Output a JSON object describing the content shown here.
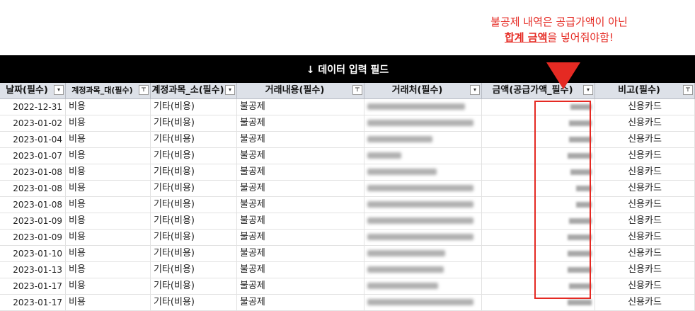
{
  "annotation": {
    "line1": "불공제 내역은 공급가액이 아닌",
    "line2_emph": "합계 금액",
    "line2_rest": "을 넣어줘야함!"
  },
  "banner": {
    "title": "↓ 데이터 입력 필드"
  },
  "columns": [
    {
      "label": "날짜(필수)",
      "filter": "▾"
    },
    {
      "label": "계정과목_대(필수)",
      "filter": "⊤"
    },
    {
      "label": "계정과목_소(필수)",
      "filter": "▾"
    },
    {
      "label": "거래내용(필수)",
      "filter": "⊤"
    },
    {
      "label": "거래처(필수)",
      "filter": "▾"
    },
    {
      "label": "금액(공급가액_필수)",
      "filter": "▾"
    },
    {
      "label": "비고(필수)",
      "filter": "⊤"
    }
  ],
  "rows": [
    {
      "date": "2022-12-31",
      "cat1": "비용",
      "cat2": "기타(비용)",
      "desc": "불공제",
      "note": "신용카드"
    },
    {
      "date": "2023-01-02",
      "cat1": "비용",
      "cat2": "기타(비용)",
      "desc": "불공제",
      "note": "신용카드"
    },
    {
      "date": "2023-01-04",
      "cat1": "비용",
      "cat2": "기타(비용)",
      "desc": "불공제",
      "note": "신용카드"
    },
    {
      "date": "2023-01-07",
      "cat1": "비용",
      "cat2": "기타(비용)",
      "desc": "불공제",
      "note": "신용카드"
    },
    {
      "date": "2023-01-08",
      "cat1": "비용",
      "cat2": "기타(비용)",
      "desc": "불공제",
      "note": "신용카드"
    },
    {
      "date": "2023-01-08",
      "cat1": "비용",
      "cat2": "기타(비용)",
      "desc": "불공제",
      "note": "신용카드"
    },
    {
      "date": "2023-01-08",
      "cat1": "비용",
      "cat2": "기타(비용)",
      "desc": "불공제",
      "note": "신용카드"
    },
    {
      "date": "2023-01-09",
      "cat1": "비용",
      "cat2": "기타(비용)",
      "desc": "불공제",
      "note": "신용카드"
    },
    {
      "date": "2023-01-09",
      "cat1": "비용",
      "cat2": "기타(비용)",
      "desc": "불공제",
      "note": "신용카드"
    },
    {
      "date": "2023-01-10",
      "cat1": "비용",
      "cat2": "기타(비용)",
      "desc": "불공제",
      "note": "신용카드"
    },
    {
      "date": "2023-01-13",
      "cat1": "비용",
      "cat2": "기타(비용)",
      "desc": "불공제",
      "note": "신용카드"
    },
    {
      "date": "2023-01-17",
      "cat1": "비용",
      "cat2": "기타(비용)",
      "desc": "불공제",
      "note": "신용카드"
    },
    {
      "date": "2023-01-17",
      "cat1": "비용",
      "cat2": "기타(비용)",
      "desc": "불공제",
      "note": "신용카드"
    }
  ],
  "colors": {
    "accent": "#e52a23",
    "header_bg": "#dde1e8",
    "banner_bg": "#000000"
  }
}
